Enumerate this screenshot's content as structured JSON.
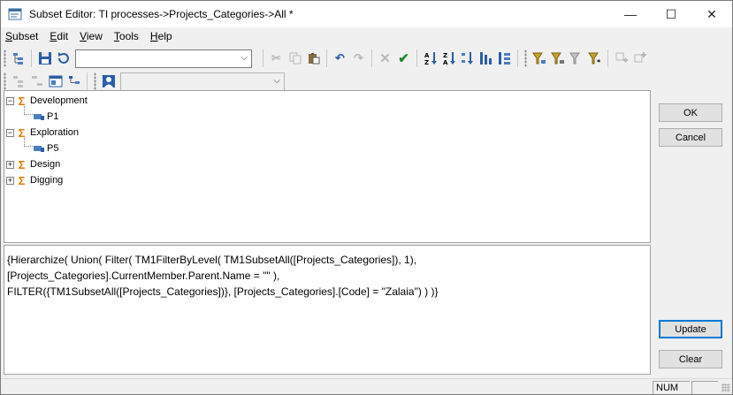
{
  "window": {
    "title": "Subset Editor:  TI processes->Projects_Categories->All  *",
    "minimize": "—",
    "maximize": "☐",
    "close": "✕"
  },
  "menu": {
    "items": [
      {
        "label": "Subset",
        "u": "S",
        "rest": "ubset"
      },
      {
        "label": "Edit",
        "u": "E",
        "rest": "dit"
      },
      {
        "label": "View",
        "u": "V",
        "rest": "iew"
      },
      {
        "label": "Tools",
        "u": "T",
        "rest": "ools"
      },
      {
        "label": "Help",
        "u": "H",
        "rest": "elp"
      }
    ]
  },
  "toolbar": {
    "subset_combo_value": "",
    "alias_combo_value": "",
    "sort_icons": {
      "az_asc": "A↓Z",
      "za_desc": "Z↓A"
    }
  },
  "tree": {
    "nodes": [
      {
        "label": "Development",
        "type": "consolidated",
        "expanded": true
      },
      {
        "label": "P1",
        "type": "element"
      },
      {
        "label": "Exploration",
        "type": "consolidated",
        "expanded": true
      },
      {
        "label": "P5",
        "type": "element"
      },
      {
        "label": "Design",
        "type": "consolidated",
        "expanded": false
      },
      {
        "label": "Digging",
        "type": "consolidated",
        "expanded": false
      }
    ]
  },
  "mdx": {
    "lines": [
      "{Hierarchize( Union( Filter( TM1FilterByLevel( TM1SubsetAll([Projects_Categories]), 1),",
      "[Projects_Categories].CurrentMember.Parent.Name = \"\" ),",
      "FILTER({TM1SubsetAll([Projects_Categories])},   [Projects_Categories].[Code] = \"Zalaia\") ) )}"
    ]
  },
  "buttons": {
    "ok": "OK",
    "cancel": "Cancel",
    "update": "Update",
    "clear": "Clear"
  },
  "status": {
    "num": "NUM"
  },
  "colors": {
    "accent": "#0078d7",
    "sigma": "#e07b00",
    "element_icon": "#4a7fc1"
  }
}
